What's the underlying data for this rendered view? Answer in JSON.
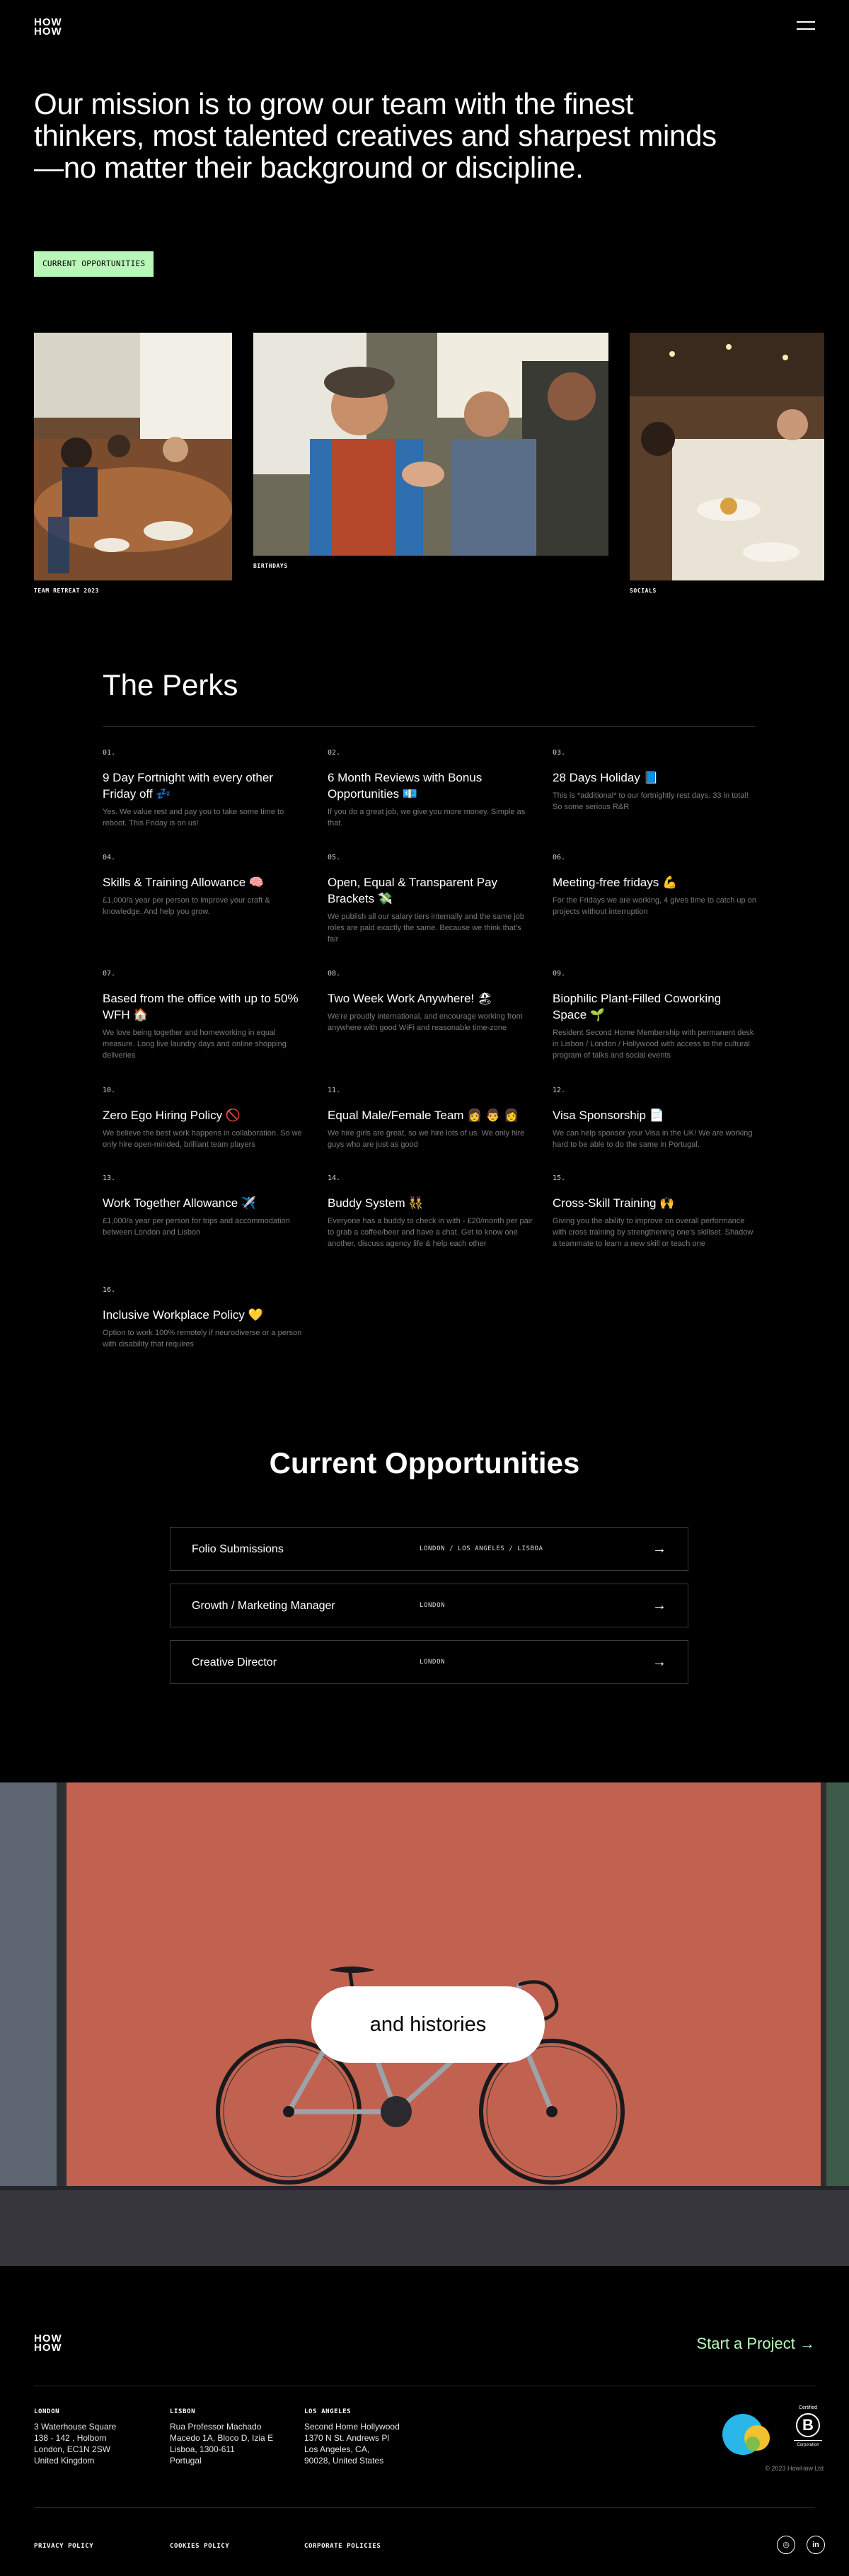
{
  "header": {
    "logo_top": "HOW",
    "logo_bottom": "HOW",
    "menu_icon": "hamburger-menu-icon"
  },
  "mission": {
    "text": "Our mission is to grow our team with the finest thinkers, most talented creatives and sharpest minds—no matter their background or discipline.",
    "button_label": "CURRENT OPPORTUNITIES"
  },
  "gallery": [
    {
      "caption": "TEAM RETREAT 2023"
    },
    {
      "caption": "BIRTHDAYS"
    },
    {
      "caption": "SOCIALS"
    }
  ],
  "perks": {
    "title": "The Perks",
    "items": [
      {
        "num": "01.",
        "title": "9 Day Fortnight with every other Friday off 💤",
        "desc": "Yes. We value rest and pay you to take some time to reboot. This Friday is on us!"
      },
      {
        "num": "02.",
        "title": "6 Month Reviews with Bonus Opportunities 💶",
        "desc": "If you do a great job, we give you more money. Simple as that."
      },
      {
        "num": "03.",
        "title": "28 Days Holiday 📘",
        "desc": "This is *additional* to our fortnightly rest days. 33 in total! So some serious R&R"
      },
      {
        "num": "04.",
        "title": "Skills & Training Allowance 🧠",
        "desc": "£1,000/a year per person to improve your craft & knowledge. And help you grow."
      },
      {
        "num": "05.",
        "title": "Open, Equal & Transparent Pay Brackets 💸",
        "desc": "We publish all our salary tiers internally and the same job roles are paid exactly the same. Because we think that's fair"
      },
      {
        "num": "06.",
        "title": "Meeting-free fridays 💪",
        "desc": "For the Fridays we are working, 4 gives time to catch up on projects without interruption"
      },
      {
        "num": "07.",
        "title": "Based from the office with up to 50% WFH 🏠",
        "desc": "We love being together and homeworking in equal measure. Long live laundry days and online shopping deliveries"
      },
      {
        "num": "08.",
        "title": "Two Week Work Anywhere! 🏖",
        "desc": "We're proudly international, and encourage working from anywhere with good WiFi and reasonable time-zone"
      },
      {
        "num": "09.",
        "title": "Biophilic Plant-Filled Coworking Space 🌱",
        "desc": "Resident Second Home Membership with permanent desk in Lisbon / London / Hollywood with access to the cultural program of talks and social events"
      },
      {
        "num": "10.",
        "title": "Zero Ego Hiring Policy 🚫",
        "desc": "We believe the best work happens in collaboration. So we only hire open-minded, brilliant team players"
      },
      {
        "num": "11.",
        "title": "Equal Male/Female Team 👩 👨 👩",
        "desc": "We hire girls are great, so we hire lots of us. We only hire guys who are just as good"
      },
      {
        "num": "12.",
        "title": "Visa Sponsorship 📄",
        "desc": "We can help sponsor your Visa in the UK! We are working hard to be able to do the same in Portugal."
      },
      {
        "num": "13.",
        "title": "Work Together Allowance ✈️",
        "desc": "£1,000/a year per person for trips and accommodation between London and Lisbon"
      },
      {
        "num": "14.",
        "title": "Buddy System 👯",
        "desc": "Everyone has a buddy to check in with - £20/month per pair to grab a coffee/beer and have a chat. Get to know one another, discuss agency life & help each other"
      },
      {
        "num": "15.",
        "title": "Cross-Skill Training 🙌",
        "desc": "Giving you the ability to improve on overall performance with cross training by strengthening one's skillset. Shadow a teammate to learn a new skill or teach one"
      },
      {
        "num": "16.",
        "title": "Inclusive Workplace Policy 💛",
        "desc": "Option to work 100% remotely if neurodiverse or a person with disability that requires"
      }
    ]
  },
  "opportunities": {
    "title": "Current Opportunities",
    "jobs": [
      {
        "title": "Folio Submissions",
        "location": "LONDON / LOS ANGELES / LISBOA"
      },
      {
        "title": "Growth / Marketing Manager",
        "location": "LONDON"
      },
      {
        "title": "Creative Director",
        "location": "LONDON"
      }
    ]
  },
  "hero": {
    "pill_text": "and histories"
  },
  "footer": {
    "logo_top": "HOW",
    "logo_bottom": "HOW",
    "cta": "Start a Project →",
    "offices": [
      {
        "city": "LONDON",
        "lines": [
          "3 Waterhouse Square",
          "138 - 142 , Holborn",
          "London, EC1N 2SW",
          "United Kingdom"
        ]
      },
      {
        "city": "LISBON",
        "lines": [
          "Rua Professor Machado",
          "Macedo 1A, Bloco D, Izia E",
          "Lisboa, 1300-611",
          "Portugal"
        ]
      },
      {
        "city": "LOS ANGELES",
        "lines": [
          "Second Home Hollywood",
          "1370 N St. Andrews Pl",
          "Los Angeles, CA,",
          "90028, United States"
        ]
      }
    ],
    "badges": {
      "living_wage": "Living Wage Employer",
      "bcorp": "Certified",
      "bcorp_sub": "Corporation"
    },
    "copyright": "2023 HowHow Ltd",
    "legal": [
      "PRIVACY POLICY",
      "COOKIES POLICY",
      "CORPORATE POLICIES"
    ],
    "social": [
      "instagram-icon",
      "linkedin-icon"
    ],
    "social_glyphs": [
      "◎",
      "in"
    ]
  },
  "colors": {
    "background": "#000000",
    "accent_green": "#b9f7b9",
    "wall_red": "#c0624f"
  }
}
